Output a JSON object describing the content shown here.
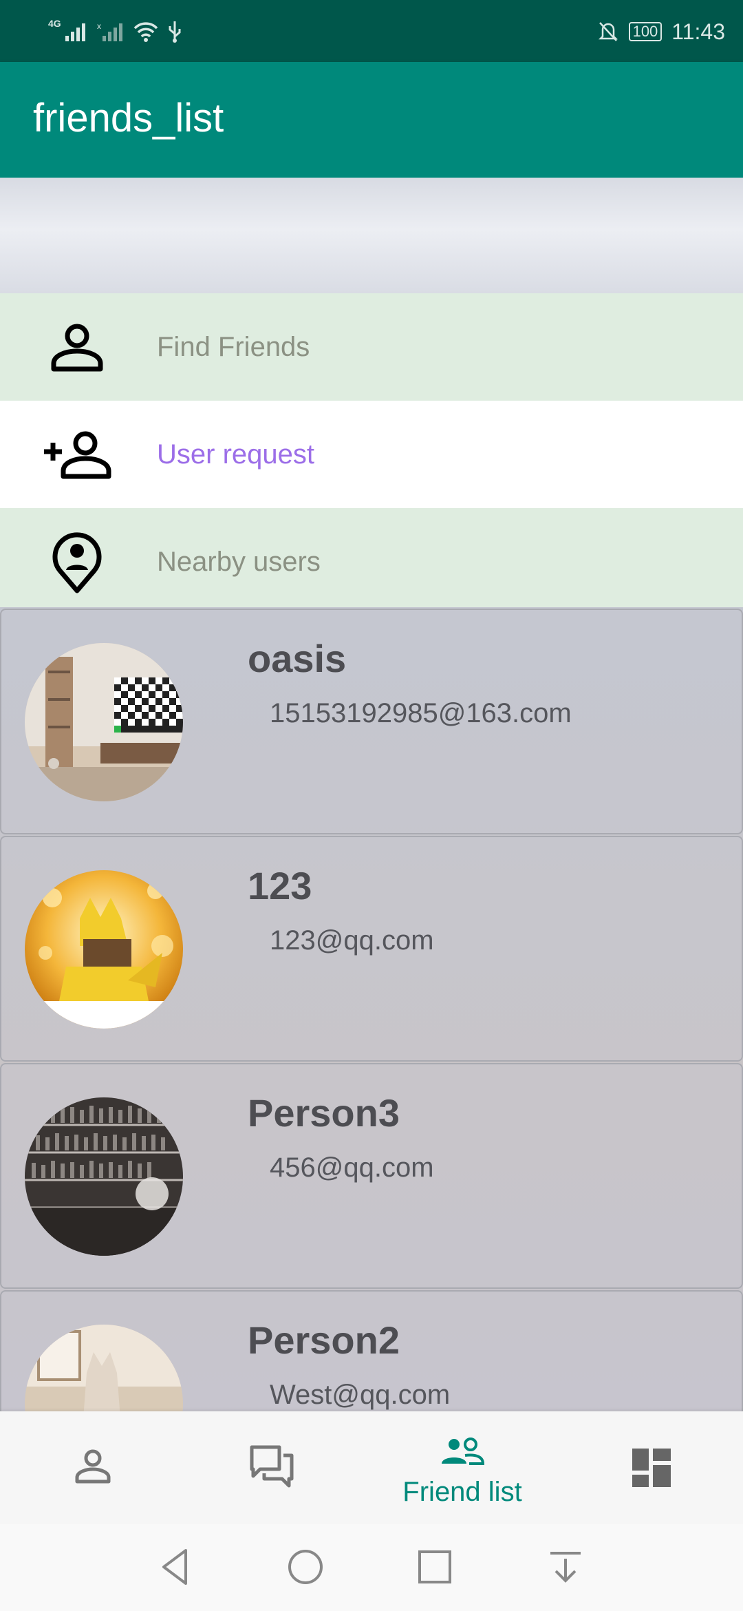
{
  "status_bar": {
    "network": "4G",
    "battery": "100",
    "time": "11:43"
  },
  "app_bar": {
    "title": "friends_list"
  },
  "menu": [
    {
      "label": "Find Friends",
      "icon": "person-icon"
    },
    {
      "label": "User request",
      "icon": "person-add-icon"
    },
    {
      "label": "Nearby users",
      "icon": "location-person-icon"
    }
  ],
  "friends": [
    {
      "name": "oasis",
      "email": "15153192985@163.com"
    },
    {
      "name": "123",
      "email": "123@qq.com"
    },
    {
      "name": "Person3",
      "email": "456@qq.com"
    },
    {
      "name": "Person2",
      "email": "West@qq.com"
    }
  ],
  "bottom_nav": {
    "items": [
      {
        "icon": "profile-icon",
        "label": ""
      },
      {
        "icon": "chat-icon",
        "label": ""
      },
      {
        "icon": "friends-icon",
        "label": "Friend list"
      },
      {
        "icon": "dashboard-icon",
        "label": ""
      }
    ],
    "active_index": 2,
    "active_color": "#00897b"
  },
  "colors": {
    "status_bar": "#00574b",
    "app_bar": "#00897b",
    "menu_green": "#dfede0",
    "highlight_purple": "#9c6ee8"
  }
}
